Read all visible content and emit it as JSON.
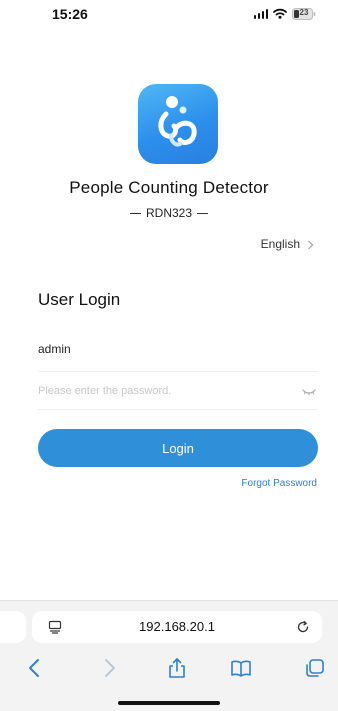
{
  "status_bar": {
    "time": "15:26",
    "battery_level": "23",
    "icons": [
      "signal-icon",
      "wifi-icon",
      "battery-icon"
    ]
  },
  "app": {
    "logo_icon": "app-logo-icon",
    "title": "People Counting Detector",
    "model": "RDN323",
    "language": "English"
  },
  "login": {
    "heading": "User Login",
    "username_value": "admin",
    "password_placeholder": "Please enter the password.",
    "password_toggle_icon": "eye-closed-icon",
    "button_label": "Login",
    "forgot_label": "Forgot Password"
  },
  "browser": {
    "url": "192.168.20.1",
    "toolbar_icons": [
      "back-icon",
      "forward-icon",
      "share-icon",
      "bookmarks-icon",
      "tabs-icon"
    ]
  },
  "colors": {
    "primary": "#2f8fd8",
    "link": "#2f7fd0",
    "logo_gradient_start": "#4fb7f5",
    "logo_gradient_end": "#2a7fe0"
  }
}
